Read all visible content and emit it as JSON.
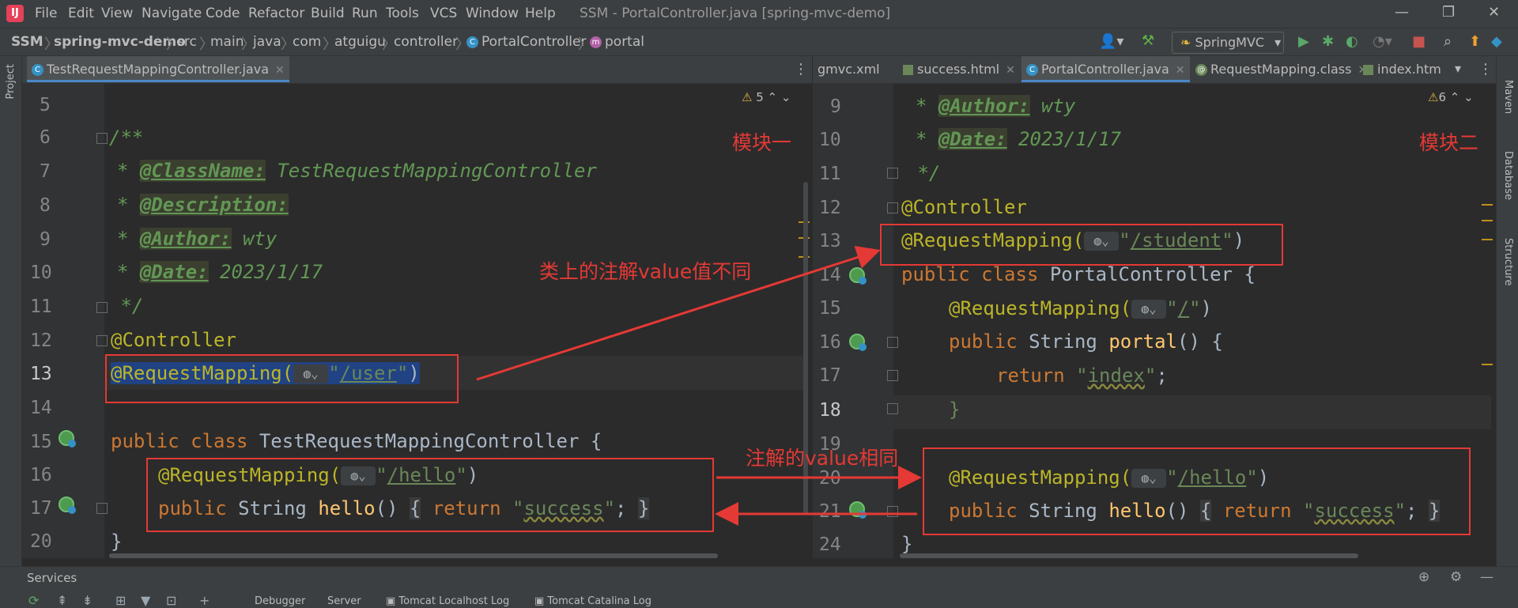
{
  "app": {
    "logo_text": "IJ",
    "menu": [
      "File",
      "Edit",
      "View",
      "Navigate",
      "Code",
      "Refactor",
      "Build",
      "Run",
      "Tools",
      "VCS",
      "Window",
      "Help"
    ],
    "title": "SSM - PortalController.java [spring-mvc-demo]",
    "window_controls": [
      "—",
      "❐",
      "✕"
    ]
  },
  "breadcrumb": [
    "SSM",
    "spring-mvc-demo",
    "src",
    "main",
    "java",
    "com",
    "atguigu",
    "controller",
    "PortalController",
    "portal"
  ],
  "toolbar": {
    "run_config": "SpringMVC",
    "icons": [
      "user-icon",
      "hammer-icon",
      "run-icon",
      "debug-icon",
      "coverage-icon",
      "profile-icon",
      "stop-icon",
      "search-icon",
      "update-icon",
      "toolbox-icon"
    ]
  },
  "side_panels": {
    "left": [
      "Project"
    ],
    "right": [
      "Maven",
      "Database",
      "Structure"
    ]
  },
  "left_editor": {
    "tabs": [
      {
        "label": "TestRequestMappingController.java",
        "active": true
      }
    ],
    "warnings": "5",
    "lines": [
      {
        "n": "5",
        "code": ""
      },
      {
        "n": "6",
        "code": "/**"
      },
      {
        "n": "7",
        "tag": "@ClassName:",
        "rest": " TestRequestMappingController"
      },
      {
        "n": "8",
        "tag": "@Description:",
        "rest": ""
      },
      {
        "n": "9",
        "tag": "@Author:",
        "rest": " wty"
      },
      {
        "n": "10",
        "tag": "@Date:",
        "rest": " 2023/1/17"
      },
      {
        "n": "11",
        "code": " */"
      },
      {
        "n": "12",
        "code": "@Controller"
      },
      {
        "n": "13",
        "code": "@RequestMapping(",
        "value": "/user"
      },
      {
        "n": "14",
        "code": ""
      },
      {
        "n": "15",
        "kw1": "public",
        "kw2": "class",
        "name": "TestRequestMappingController",
        "tail": " {"
      },
      {
        "n": "16",
        "code": "@RequestMapping(",
        "value": "/hello"
      },
      {
        "n": "17",
        "kw1": "public",
        "type": "String",
        "fn": "hello",
        "body_kw": "return",
        "body_str": "success"
      },
      {
        "n": "20",
        "code": "}"
      }
    ]
  },
  "right_editor": {
    "tabs": [
      {
        "label": "gmvc.xml",
        "active": false
      },
      {
        "label": "success.html",
        "active": false
      },
      {
        "label": "PortalController.java",
        "active": true
      },
      {
        "label": "RequestMapping.class",
        "active": false
      },
      {
        "label": "index.htm",
        "active": false
      }
    ],
    "warnings": "6",
    "lines": [
      {
        "n": "9",
        "tag": "@Author:",
        "rest": " wty"
      },
      {
        "n": "10",
        "tag": "@Date:",
        "rest": " 2023/1/17"
      },
      {
        "n": "11",
        "code": " */"
      },
      {
        "n": "12",
        "code": "@Controller"
      },
      {
        "n": "13",
        "code": "@RequestMapping(",
        "value": "/student"
      },
      {
        "n": "14",
        "kw1": "public",
        "kw2": "class",
        "name": "PortalController",
        "tail": " {"
      },
      {
        "n": "15",
        "code": "@RequestMapping(",
        "value": "/"
      },
      {
        "n": "16",
        "kw1": "public",
        "type": "String",
        "fn": "portal",
        "tail": "() {"
      },
      {
        "n": "17",
        "kw1": "return",
        "str": "index",
        "tail": ";"
      },
      {
        "n": "18",
        "code": "}"
      },
      {
        "n": "19",
        "code": ""
      },
      {
        "n": "20",
        "code": "@RequestMapping(",
        "value": "/hello"
      },
      {
        "n": "21",
        "kw1": "public",
        "type": "String",
        "fn": "hello",
        "body_kw": "return",
        "body_str": "success"
      },
      {
        "n": "24",
        "code": "}"
      }
    ]
  },
  "annotations": {
    "module1": "模块一",
    "module2": "模块二",
    "class_diff": "类上的注解value值不同",
    "method_same": "注解的value相同"
  },
  "services": {
    "title": "Services",
    "tabs": [
      "Debugger",
      "Server",
      "Tomcat Localhost Log",
      "Tomcat Catalina Log"
    ]
  },
  "colors": {
    "annotation_red": "#e53935",
    "keyword": "#cc7832",
    "string": "#6a8759",
    "comment": "#629755",
    "annotation": "#bbb529"
  }
}
